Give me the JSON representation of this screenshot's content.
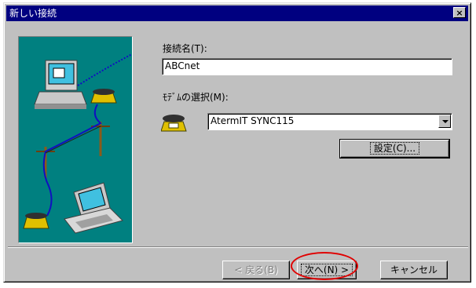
{
  "window": {
    "title": "新しい接続",
    "close_glyph": "×"
  },
  "form": {
    "name_label": "接続名(T):",
    "name_value": "ABCnet",
    "modem_label": "ﾓﾃﾞﾑの選択(M):",
    "modem_value": "AtermIT SYNC115"
  },
  "buttons": {
    "settings": "設定(C)...",
    "back": "< 戻る(B)",
    "next": "次へ(N) >",
    "cancel": "キャンセル"
  },
  "icons": {
    "illustration": "computer-phone-network-illustration",
    "modem": "telephone-modem-icon",
    "dropdown": "chevron-down-icon"
  },
  "colors": {
    "titlebar": "#000080",
    "illustration_bg": "#008080",
    "highlight_circle": "#e00000"
  }
}
